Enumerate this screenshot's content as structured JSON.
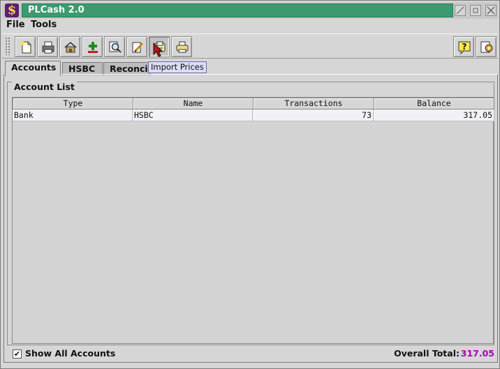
{
  "window": {
    "title": "PLCash 2.0",
    "icon": "dollar-icon"
  },
  "menu": {
    "items": [
      "File",
      "Tools"
    ]
  },
  "toolbar": {
    "buttons": [
      "new-icon",
      "print-icon",
      "home-icon",
      "add-icon",
      "search-icon",
      "edit-icon",
      "import-prices-icon",
      "printer-icon"
    ],
    "right_buttons": [
      "help-icon",
      "settings-icon"
    ],
    "tooltip": "Import Prices"
  },
  "tabs": [
    {
      "label": "Accounts",
      "active": true
    },
    {
      "label": "HSBC",
      "active": false
    },
    {
      "label": "Reconcil",
      "active": false
    }
  ],
  "account_list": {
    "title": "Account List",
    "columns": [
      "Type",
      "Name",
      "Transactions",
      "Balance"
    ],
    "rows": [
      {
        "type": "Bank",
        "name": "HSBC",
        "transactions": "73",
        "balance": "317.05"
      }
    ]
  },
  "footer": {
    "checkbox_label": "Show All Accounts",
    "checkbox_checked": true,
    "checkbox_mark": "✔",
    "total_label": "Overall Total:",
    "total_value": "317.05"
  },
  "colors": {
    "title_bar": "#3d9a6e",
    "total_value": "#b000b0",
    "tooltip_bg": "#dcdcf6"
  }
}
